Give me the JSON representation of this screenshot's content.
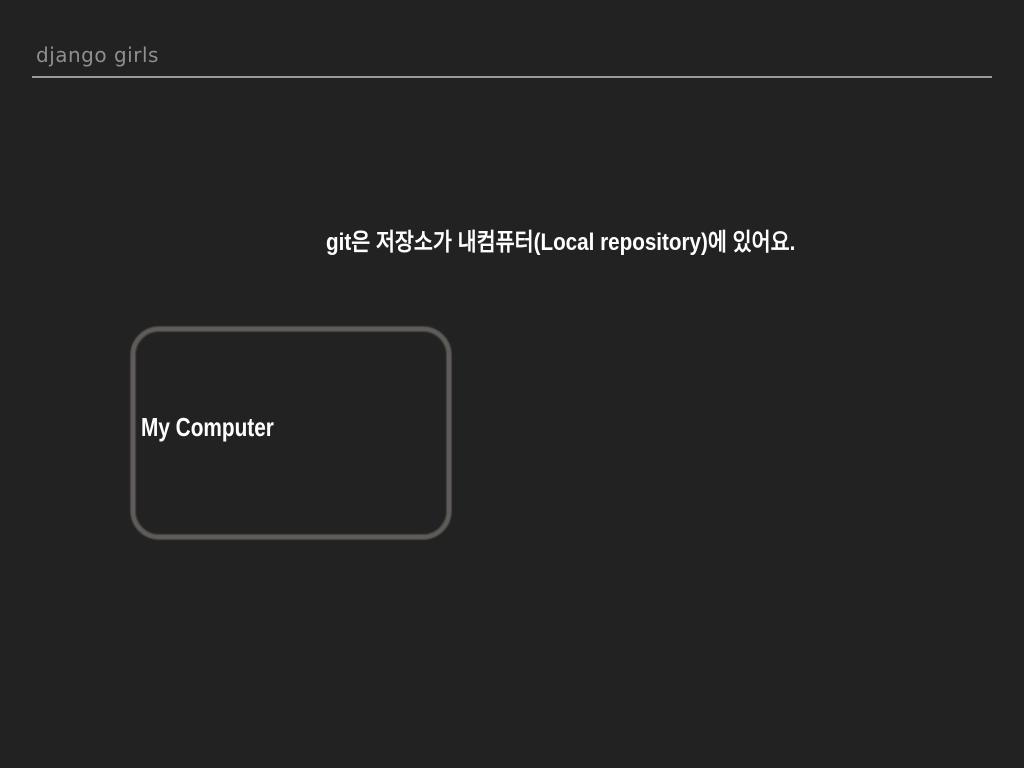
{
  "header": {
    "title": "django girls"
  },
  "slide": {
    "caption": "git은 저장소가 내컴퓨터(Local repository)에 있어요.",
    "box_label": "My Computer"
  },
  "colors": {
    "background": "#222222",
    "header_text": "#8f8f8f",
    "rule": "#9a9a9a",
    "box_border": "#5e5b58",
    "text": "#ffffff"
  }
}
